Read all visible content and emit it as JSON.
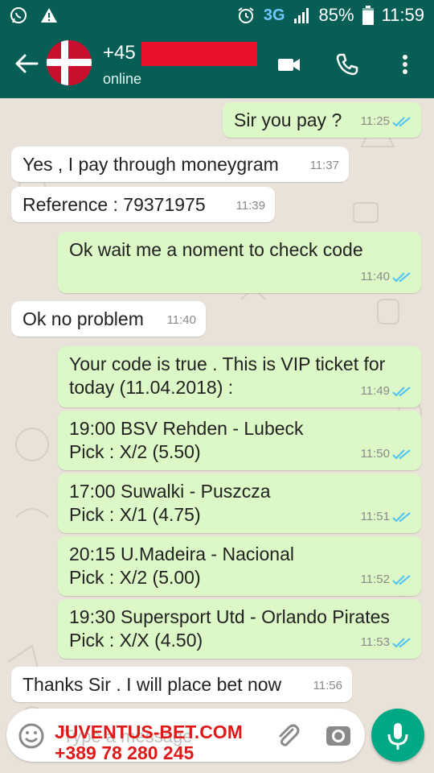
{
  "status_bar": {
    "network": "3G",
    "battery": "85%",
    "time": "11:59",
    "icons": [
      "whatsapp-icon",
      "warning-icon",
      "alarm-icon",
      "signal-icon",
      "battery-icon"
    ]
  },
  "header": {
    "contact_prefix": "+45",
    "status": "online",
    "icons": [
      "back-arrow-icon",
      "denmark-flag-avatar",
      "video-call-icon",
      "phone-icon",
      "more-vertical-icon"
    ]
  },
  "messages": [
    {
      "dir": "out",
      "lines": [
        "Sir you pay ?"
      ],
      "time": "11:25",
      "read": true
    },
    {
      "dir": "in",
      "lines": [
        "Yes , I pay through moneygram"
      ],
      "time": "11:37"
    },
    {
      "dir": "in",
      "lines": [
        "Reference : 79371975"
      ],
      "time": "11:39"
    },
    {
      "dir": "out",
      "lines": [
        "Ok wait me a noment to check code"
      ],
      "time": "11:40",
      "read": true
    },
    {
      "dir": "in",
      "lines": [
        "Ok no problem"
      ],
      "time": "11:40"
    },
    {
      "dir": "out",
      "lines": [
        "Your code is true . This is VIP ticket for",
        "today (11.04.2018) :"
      ],
      "time": "11:49",
      "read": true
    },
    {
      "dir": "out",
      "lines": [
        "19:00 BSV Rehden - Lubeck",
        "Pick : X/2 (5.50)"
      ],
      "time": "11:50",
      "read": true
    },
    {
      "dir": "out",
      "lines": [
        "17:00 Suwalki - Puszcza",
        "Pick : X/1 (4.75)"
      ],
      "time": "11:51",
      "read": true
    },
    {
      "dir": "out",
      "lines": [
        "20:15 U.Madeira - Nacional",
        "Pick : X/2 (5.00)"
      ],
      "time": "11:52",
      "read": true
    },
    {
      "dir": "out",
      "lines": [
        "19:30 Supersport Utd - Orlando Pirates",
        "Pick : X/X (4.50)"
      ],
      "time": "11:53",
      "read": true
    },
    {
      "dir": "in",
      "lines": [
        "Thanks Sir . I will place bet now"
      ],
      "time": "11:56"
    }
  ],
  "input": {
    "placeholder": "Type a message",
    "icons": [
      "emoji-icon",
      "attach-icon",
      "camera-icon",
      "mic-icon"
    ]
  },
  "watermark": {
    "line1": "JUVENTUS-BET.COM",
    "line2": "+389 78 280 245"
  },
  "colors": {
    "header": "#075e54",
    "outgoing_bubble": "#dcf8c6",
    "incoming_bubble": "#ffffff",
    "read_ticks": "#4fc3f7",
    "mic_button": "#00a884",
    "watermark": "#e01818"
  }
}
